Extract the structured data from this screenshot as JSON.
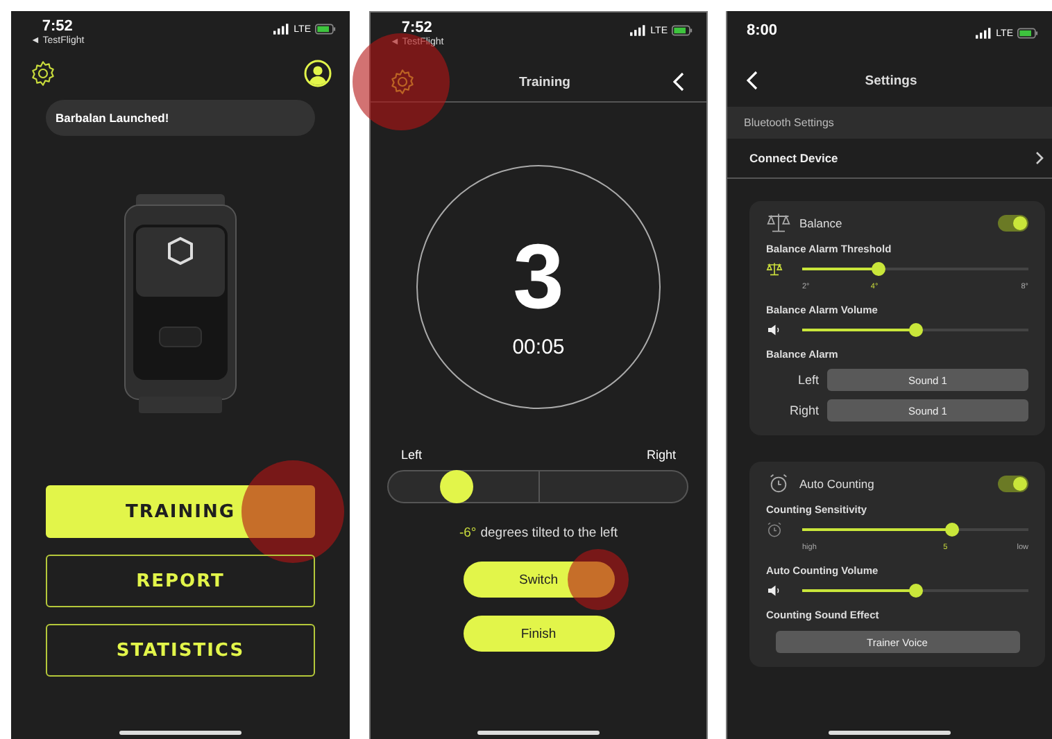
{
  "home": {
    "status": {
      "time": "7:52",
      "back_app": "◄ TestFlight",
      "network": "LTE"
    },
    "toast": "Barbalan Launched!",
    "buttons": [
      {
        "label": "TRAINING",
        "selected": true,
        "tapped": true
      },
      {
        "label": "REPORT",
        "selected": false,
        "tapped": false
      },
      {
        "label": "STATISTICS",
        "selected": false,
        "tapped": false
      }
    ]
  },
  "training": {
    "status": {
      "time": "7:52",
      "back_app": "◄ TestFlight",
      "network": "LTE"
    },
    "settings_tapped": true,
    "title": "Training",
    "countdown": "3",
    "timer": "00:05",
    "tilt": {
      "left_label": "Left",
      "right_label": "Right",
      "level": 0.23,
      "value": "-6°",
      "message": "degrees tilted to the left"
    },
    "buttons": [
      {
        "label": "Switch",
        "tapped": true
      },
      {
        "label": "Finish",
        "tapped": false
      }
    ]
  },
  "settings": {
    "status": {
      "time": "8:00",
      "network": "LTE"
    },
    "title": "Settings",
    "section_header": "Bluetooth Settings",
    "connect_label": "Connect Device",
    "groups": [
      {
        "kind": "balance",
        "title": "Balance",
        "on": true,
        "rows": [
          {
            "kind": "slider",
            "label": "Balance Alarm Threshold",
            "level": 0.34,
            "ticks": [
              "2°",
              "4°",
              "8°"
            ]
          },
          {
            "kind": "volume",
            "label": "Balance Alarm Volume",
            "level": 0.5
          },
          {
            "kind": "choices",
            "label": "Balance Alarm",
            "options": [
              {
                "label": "Left",
                "value": "Sound 1"
              },
              {
                "label": "Right",
                "value": "Sound 1"
              }
            ]
          }
        ]
      },
      {
        "kind": "counting",
        "title": "Auto Counting",
        "on": true,
        "rows": [
          {
            "kind": "slider",
            "label": "Counting Sensitivity",
            "level": 0.66,
            "ticks": [
              "high",
              "5",
              "low"
            ]
          },
          {
            "kind": "volume",
            "label": "Auto Counting Volume",
            "level": 0.5
          },
          {
            "kind": "button",
            "label": "Counting Sound Effect",
            "value": "Trainer Voice"
          }
        ]
      }
    ]
  }
}
